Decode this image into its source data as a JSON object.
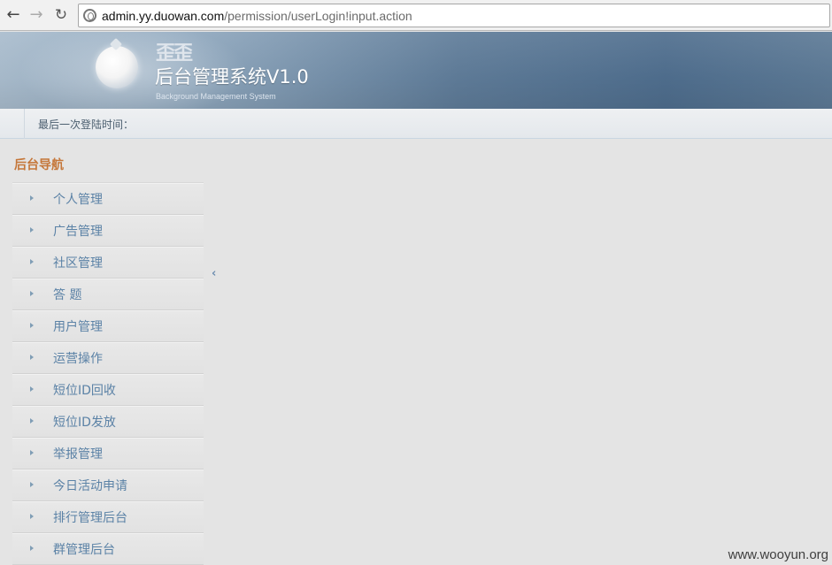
{
  "browser": {
    "back_icon": "arrow-left-icon",
    "forward_icon": "arrow-right-icon",
    "reload_icon": "reload-icon",
    "url_host": "admin.yy.duowan.com",
    "url_path": "/permission/userLogin!input.action"
  },
  "banner": {
    "logo_mark": "歪歪",
    "title": "后台管理系统V1.0",
    "subtitle": "Background Management System"
  },
  "login_info": {
    "label": "最后一次登陆时间："
  },
  "sidebar": {
    "title": "后台导航",
    "items": [
      {
        "label": "个人管理"
      },
      {
        "label": "广告管理"
      },
      {
        "label": "社区管理"
      },
      {
        "label": "答 题"
      },
      {
        "label": "用户管理"
      },
      {
        "label": "运营操作"
      },
      {
        "label": "短位ID回收"
      },
      {
        "label": "短位ID发放"
      },
      {
        "label": "举报管理"
      },
      {
        "label": "今日活动申请"
      },
      {
        "label": "排行管理后台"
      },
      {
        "label": "群管理后台"
      }
    ]
  },
  "watermark": "www.wooyun.org",
  "colors": {
    "nav_title": "#c5773a",
    "nav_item_text": "#5b82a6",
    "banner_dark": "#4f6e8e"
  }
}
